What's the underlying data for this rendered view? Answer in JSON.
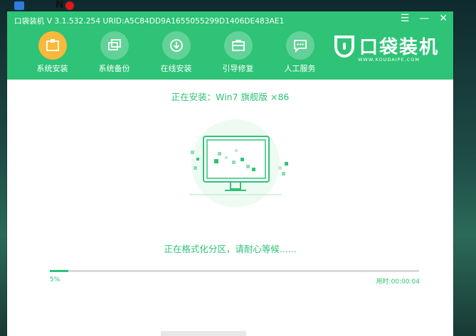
{
  "window": {
    "title": "口袋装机 V 3.1.532.254 URID:A5C84DD9A1655055299D1406DE483AE1",
    "controls": {
      "menu": "☰",
      "minimize": "—",
      "close": "✕"
    }
  },
  "nav": {
    "items": [
      {
        "label": "系统安装",
        "icon": "install-icon",
        "active": true
      },
      {
        "label": "系统备份",
        "icon": "backup-icon",
        "active": false
      },
      {
        "label": "在线安装",
        "icon": "online-install-icon",
        "active": false
      },
      {
        "label": "引导修复",
        "icon": "boot-repair-icon",
        "active": false
      },
      {
        "label": "人工服务",
        "icon": "chat-icon",
        "active": false
      }
    ]
  },
  "brand": {
    "name": "口袋装机",
    "url": "WWW.KOUDAIPE.COM"
  },
  "install": {
    "title": "正在安装：Win7 旗舰版 ×86",
    "status": "正在格式化分区，请耐心等候......",
    "progress_percent": 5,
    "progress_label": "5%",
    "elapsed": "用时:00:00:04"
  },
  "colors": {
    "accent": "#2ec376",
    "active_nav": "#f9b93b"
  }
}
